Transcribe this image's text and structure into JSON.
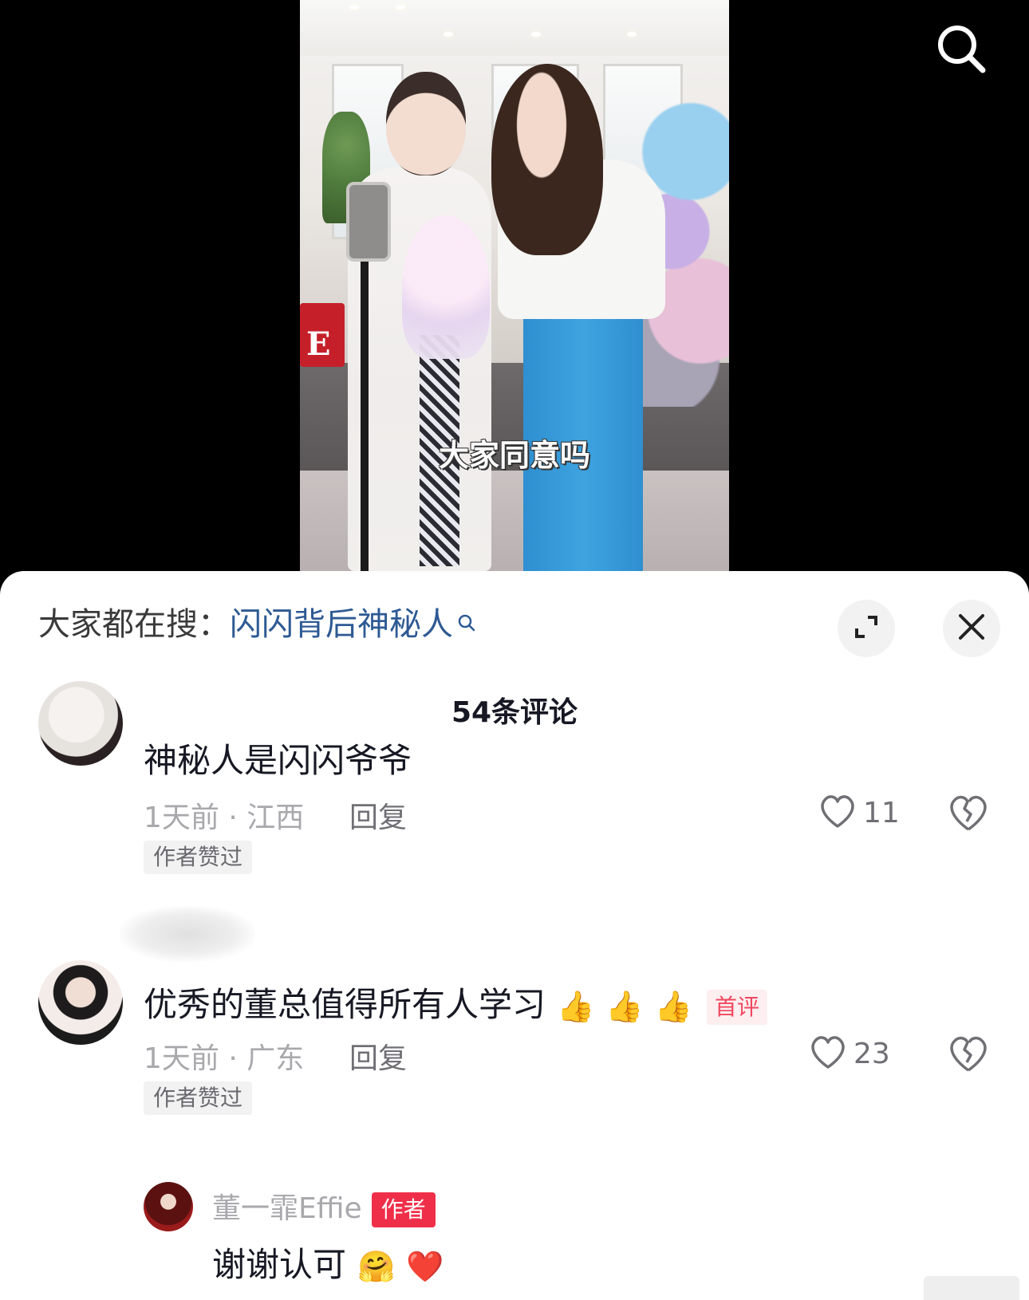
{
  "video": {
    "subtitle": "大家同意吗",
    "search_icon": "search-icon"
  },
  "panel": {
    "hot_search_prefix": "大家都在搜：",
    "hot_search_term": "闪闪背后神秘人",
    "expand_icon": "expand-icon",
    "close_icon": "close-icon",
    "comment_count": "54条评论"
  },
  "comments": [
    {
      "text": "神秘人是闪闪爷爷",
      "meta": "1天前 · 江西",
      "reply_label": "回复",
      "likes": "11",
      "author_liked": "作者赞过"
    },
    {
      "text": "优秀的董总值得所有人学习",
      "emojis": [
        "👍",
        "👍",
        "👍"
      ],
      "first_tag": "首评",
      "meta": "1天前 · 广东",
      "reply_label": "回复",
      "likes": "23",
      "author_liked": "作者赞过",
      "reply": {
        "name": "董一霏Effie",
        "tag": "作者",
        "text": "谢谢认可",
        "emojis": [
          "🤗",
          "❤️"
        ]
      }
    }
  ],
  "colors": {
    "link": "#2e5a94",
    "author_tag": "#ef2f4a",
    "first_tag": "#f0475e",
    "muted": "#a8a8ad"
  }
}
